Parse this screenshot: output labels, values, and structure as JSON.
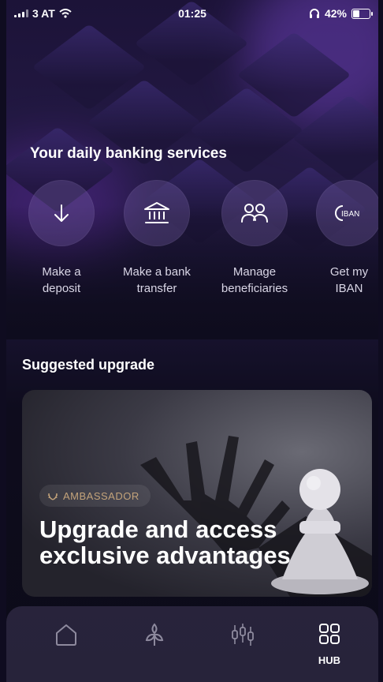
{
  "status_bar": {
    "carrier": "3 AT",
    "time": "01:25",
    "battery": "42%",
    "battery_level": 0.42,
    "icons": [
      "signal-icon",
      "wifi-icon",
      "headphones-icon",
      "battery-icon"
    ]
  },
  "daily_services": {
    "title": "Your daily banking services",
    "items": [
      {
        "line1": "Make a",
        "line2": "deposit",
        "icon": "arrow-down-icon"
      },
      {
        "line1": "Make a bank",
        "line2": "transfer",
        "icon": "bank-icon"
      },
      {
        "line1": "Manage",
        "line2": "beneficiaries",
        "icon": "people-icon"
      },
      {
        "line1": "Get my",
        "line2": "IBAN",
        "icon": "iban-icon",
        "icon_text": "IBAN"
      }
    ]
  },
  "suggested": {
    "title": "Suggested upgrade",
    "badge": "AMBASSADOR",
    "card_title_line1": "Upgrade and access",
    "card_title_line2": "exclusive advantages"
  },
  "tab_bar": {
    "items": [
      {
        "icon": "home-icon",
        "label": ""
      },
      {
        "icon": "plant-icon",
        "label": ""
      },
      {
        "icon": "candlestick-icon",
        "label": ""
      },
      {
        "icon": "grid-icon",
        "label": "HUB",
        "active": true
      }
    ]
  },
  "colors": {
    "background": "#0e0c1d",
    "badge_text": "#c3a37a",
    "tabbar": "#2a263e"
  }
}
